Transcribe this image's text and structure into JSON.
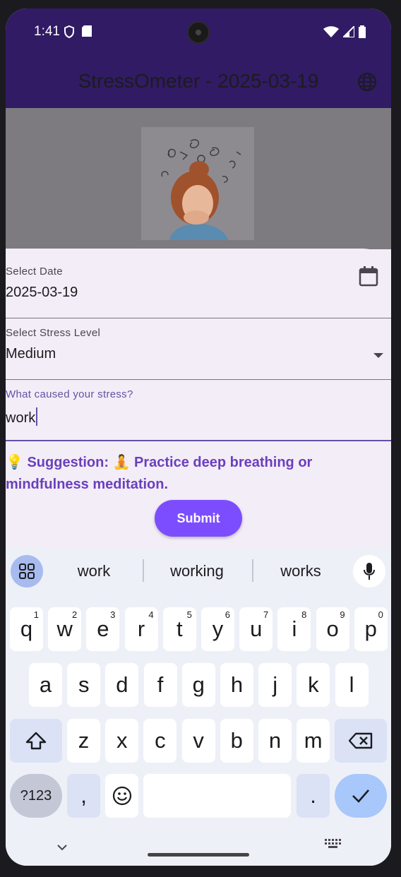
{
  "status_bar": {
    "time": "1:41"
  },
  "app_bar": {
    "title": "StressOmeter - 2025-03-19"
  },
  "form": {
    "date_label": "Select Date",
    "date_value": "2025-03-19",
    "stress_label": "Select Stress Level",
    "stress_value": "Medium",
    "cause_label": "What caused your stress?",
    "cause_value": "work",
    "suggestion": "💡 Suggestion: 🧘 Practice deep breathing or mindfulness meditation.",
    "submit_label": "Submit"
  },
  "keyboard": {
    "suggestions": [
      "work",
      "working",
      "works"
    ],
    "row1": [
      {
        "k": "q",
        "h": "1"
      },
      {
        "k": "w",
        "h": "2"
      },
      {
        "k": "e",
        "h": "3"
      },
      {
        "k": "r",
        "h": "4"
      },
      {
        "k": "t",
        "h": "5"
      },
      {
        "k": "y",
        "h": "6"
      },
      {
        "k": "u",
        "h": "7"
      },
      {
        "k": "i",
        "h": "8"
      },
      {
        "k": "o",
        "h": "9"
      },
      {
        "k": "p",
        "h": "0"
      }
    ],
    "row2": [
      "a",
      "s",
      "d",
      "f",
      "g",
      "h",
      "j",
      "k",
      "l"
    ],
    "row3": [
      "z",
      "x",
      "c",
      "v",
      "b",
      "n",
      "m"
    ],
    "symbols_label": "?123",
    "comma_label": ",",
    "period_label": "."
  },
  "colors": {
    "app_bar": "#311b64",
    "accent": "#6750a4",
    "button": "#7c4dff",
    "sheet": "#f3edf7"
  }
}
